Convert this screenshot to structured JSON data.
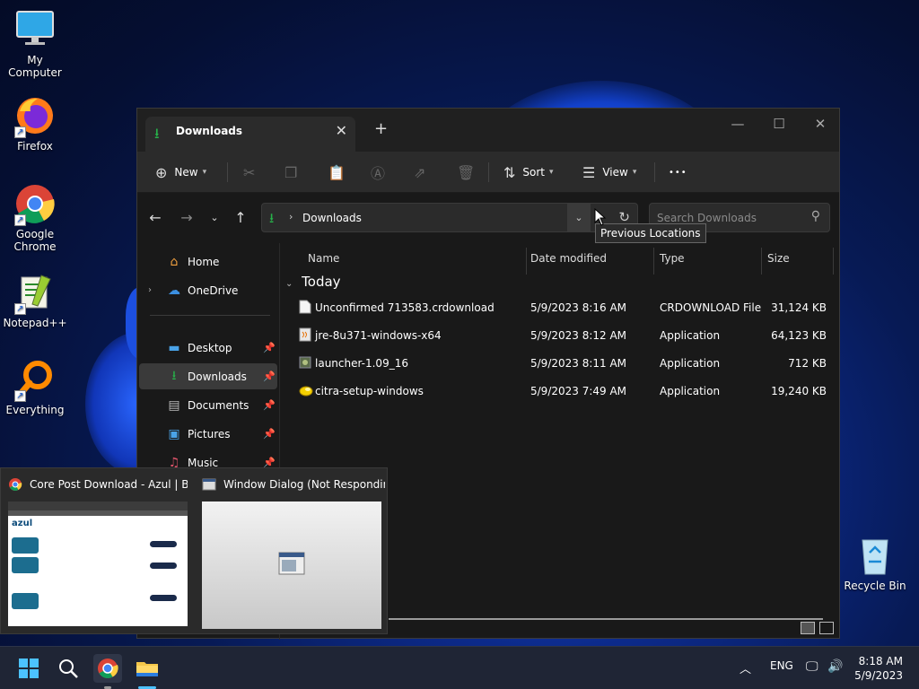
{
  "desktop": {
    "icons": [
      {
        "label": "My Computer",
        "icon": "monitor-icon"
      },
      {
        "label": "Firefox",
        "icon": "firefox-icon"
      },
      {
        "label": "Google Chrome",
        "icon": "chrome-icon"
      },
      {
        "label": "Notepad++",
        "icon": "notepadpp-icon"
      },
      {
        "label": "Everything",
        "icon": "everything-search-icon"
      }
    ],
    "recycle_bin": "Recycle Bin"
  },
  "window": {
    "tab_title": "Downloads",
    "new_tab_glyph": "+",
    "toolbar": {
      "new_label": "New",
      "sort_label": "Sort",
      "view_label": "View",
      "more_label": "•••"
    },
    "address": {
      "path": "Downloads",
      "tooltip": "Previous Locations"
    },
    "search": {
      "placeholder": "Search Downloads"
    },
    "nav": [
      {
        "label": "Home",
        "icon": "home-icon"
      },
      {
        "label": "OneDrive",
        "icon": "onedrive-icon"
      },
      {
        "label": "Desktop",
        "icon": "desktop-folder-icon"
      },
      {
        "label": "Downloads",
        "icon": "downloads-folder-icon"
      },
      {
        "label": "Documents",
        "icon": "documents-folder-icon"
      },
      {
        "label": "Pictures",
        "icon": "pictures-folder-icon"
      },
      {
        "label": "Music",
        "icon": "music-folder-icon"
      }
    ],
    "columns": {
      "name": "Name",
      "date": "Date modified",
      "type": "Type",
      "size": "Size"
    },
    "group": "Today",
    "files": [
      {
        "name": "Unconfirmed 713583.crdownload",
        "date": "5/9/2023 8:16 AM",
        "type": "CRDOWNLOAD File",
        "size": "31,124 KB"
      },
      {
        "name": "jre-8u371-windows-x64",
        "date": "5/9/2023 8:12 AM",
        "type": "Application",
        "size": "64,123 KB"
      },
      {
        "name": "launcher-1.09_16",
        "date": "5/9/2023 8:11 AM",
        "type": "Application",
        "size": "712 KB"
      },
      {
        "name": "citra-setup-windows",
        "date": "5/9/2023 7:49 AM",
        "type": "Application",
        "size": "19,240 KB"
      }
    ]
  },
  "thumbnails": [
    {
      "title": "Core Post Download - Azul | Be...",
      "icon": "chrome-icon"
    },
    {
      "title": "Window Dialog (Not Respondin...",
      "icon": "window-dialog-icon"
    }
  ],
  "thumb_logo": "azul",
  "taskbar": {
    "lang": "ENG",
    "time": "8:18 AM",
    "date": "5/9/2023"
  },
  "colors": {
    "accent_green": "#27b24a",
    "window_bg": "#191919",
    "toolbar_bg": "#2b2b2b"
  }
}
